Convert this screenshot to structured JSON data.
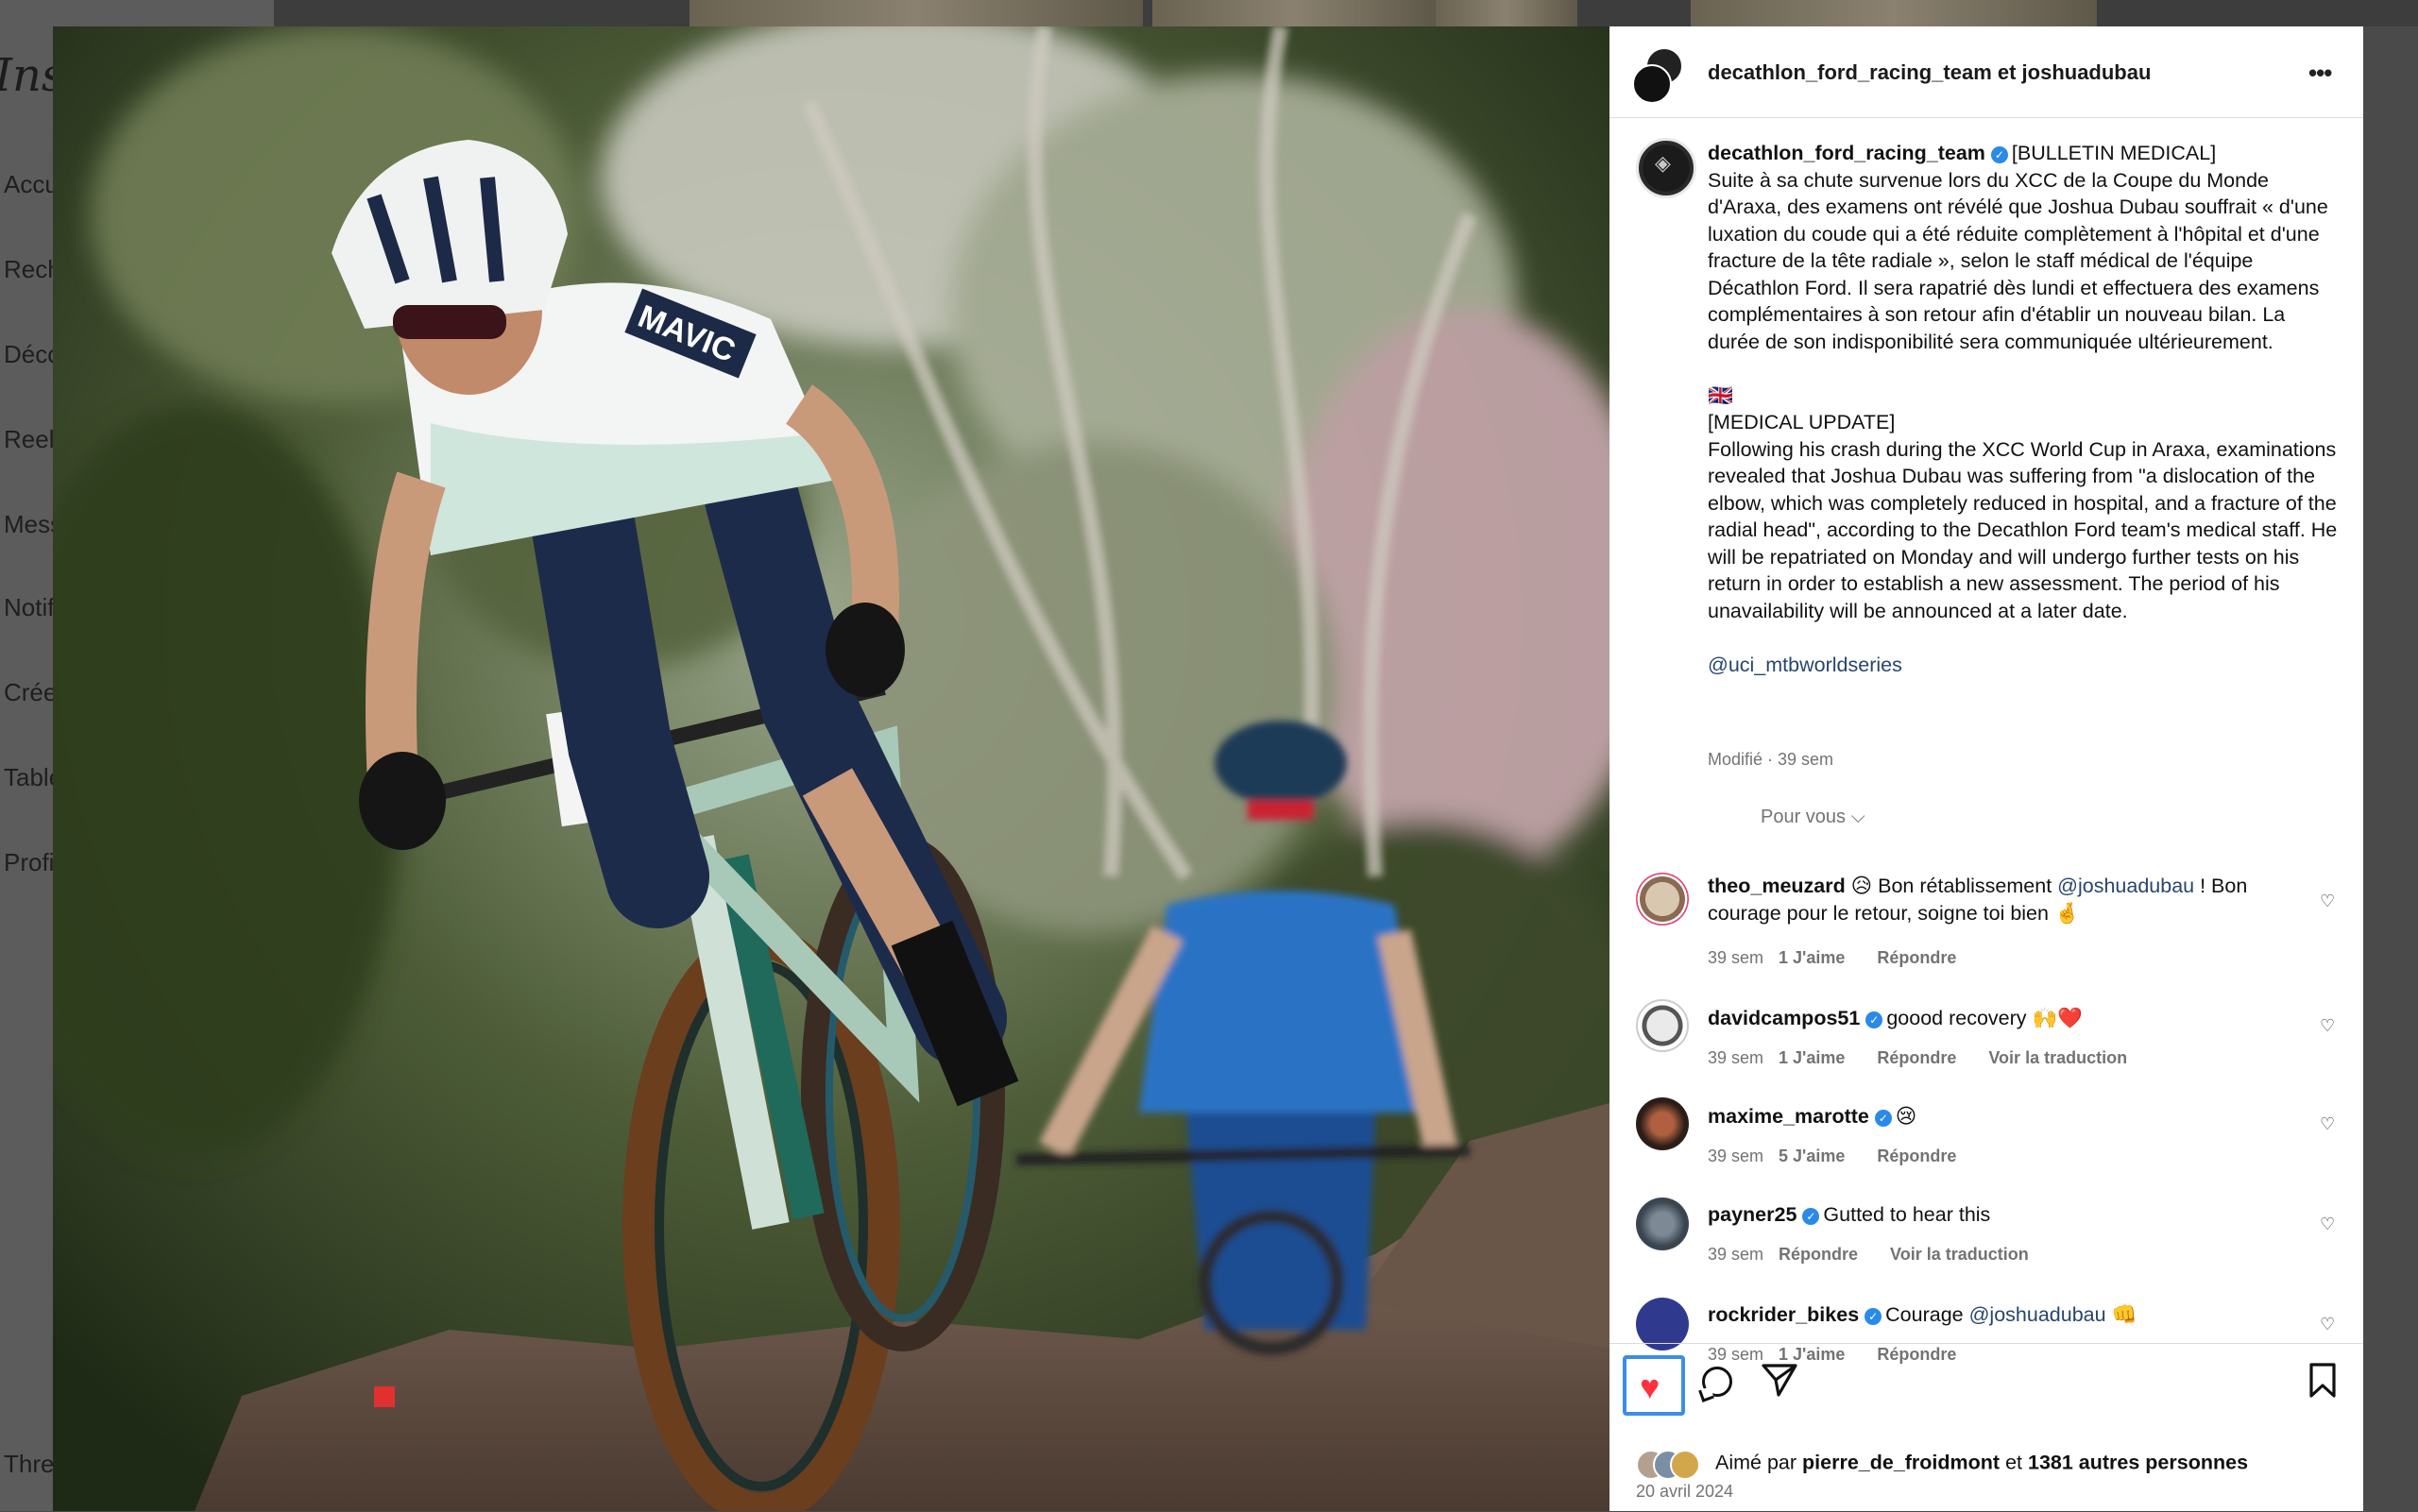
{
  "background": {
    "logo": "Instagr",
    "nav": [
      "Accu",
      "Rech",
      "Déco",
      "Reels",
      "Mess",
      "Notif",
      "Crée",
      "Table",
      "Profi",
      "Thre"
    ]
  },
  "post": {
    "header_title": "decathlon_ford_racing_team et joshuadubau",
    "author": "decathlon_ford_racing_team",
    "caption_fr": "[BULLETIN MEDICAL]\nSuite à sa chute survenue lors du XCC de la Coupe du Monde d'Araxa, des examens ont révélé que Joshua Dubau souffrait « d'une luxation du coude qui a été réduite complètement à l'hôpital et d'une fracture de la tête radiale », selon le staff médical de l'équipe Décathlon Ford. Il sera rapatrié dès lundi et effectuera des examens complémentaires à son retour afin d'établir un nouveau bilan. La durée de son indisponibilité sera communiquée ultérieurement.",
    "flag": "🇬🇧",
    "caption_en": "[MEDICAL UPDATE]\nFollowing his crash during the XCC World Cup in Araxa, examinations revealed that Joshua Dubau was suffering from \"a dislocation of the elbow, which was completely reduced in hospital, and a fracture of the radial head\", according to the Decathlon Ford team's medical staff. He will be repatriated on Monday and will undergo further tests on his return in order to establish a new assessment. The period of his unavailability will be announced at a later date.",
    "mention": "@uci_mtbworldseries",
    "modified": "Modifié · 39 sem"
  },
  "sort_label": "Pour vous",
  "comments": [
    {
      "user": "theo_meuzard",
      "verified": false,
      "pre": "😥 Bon rétablissement ",
      "mention": "@joshuadubau",
      "post": " ! Bon courage pour le retour, soigne toi bien 🤞",
      "age": "39 sem",
      "likes": "1 J'aime",
      "reply": "Répondre",
      "translate": ""
    },
    {
      "user": "davidcampos51",
      "verified": true,
      "pre": "goood recovery 🙌❤️",
      "mention": "",
      "post": "",
      "age": "39 sem",
      "likes": "1 J'aime",
      "reply": "Répondre",
      "translate": "Voir la traduction"
    },
    {
      "user": "maxime_marotte",
      "verified": true,
      "pre": "😢",
      "mention": "",
      "post": "",
      "age": "39 sem",
      "likes": "5 J'aime",
      "reply": "Répondre",
      "translate": ""
    },
    {
      "user": "payner25",
      "verified": true,
      "pre": "Gutted to hear this",
      "mention": "",
      "post": "",
      "age": "39 sem",
      "likes": "",
      "reply": "Répondre",
      "translate": "Voir la traduction"
    },
    {
      "user": "rockrider_bikes",
      "verified": true,
      "pre": "Courage ",
      "mention": "@joshuadubau",
      "post": " 👊",
      "age": "39 sem",
      "likes": "1 J'aime",
      "reply": "Répondre",
      "translate": ""
    }
  ],
  "likes_line": {
    "prefix": "Aimé par ",
    "user": "pierre_de_froidmont",
    "mid": " et ",
    "count": "1381 autres personnes"
  },
  "date": "20 avril 2024",
  "colors": {
    "accent_link": "#27456d",
    "verified": "#2a8ae8",
    "heart": "#ff3040",
    "selection": "#3b8ee8"
  }
}
